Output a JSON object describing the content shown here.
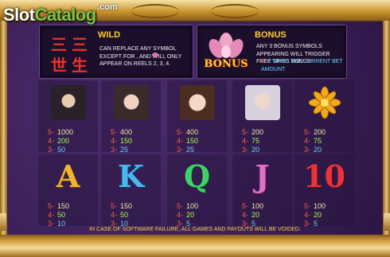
{
  "logo": {
    "text_a": "Slot",
    "text_b": "Catalog",
    "suffix": ".com"
  },
  "wild": {
    "title": "WILD",
    "chars": [
      "三",
      "三",
      "世",
      "生"
    ],
    "text": "CAN REPLACE ANY SYMBOL EXCEPT FOR , AND WILL ONLY APPEAR ON REELS 2, 3, 4."
  },
  "bonus": {
    "title": "BONUS",
    "icon_label": "BONUS",
    "text": "ANY 3 BONUS SYMBOLS APPEARING WILL TRIGGER FREE SPINS BONUS",
    "line_key": "3-",
    "line_value": "2 TIMES THE CURRENT BET AMOUNT."
  },
  "symbols": [
    {
      "name": "warrior",
      "pays": [
        [
          "5-",
          "1000"
        ],
        [
          "4-",
          "200"
        ],
        [
          "3-",
          "50"
        ]
      ]
    },
    {
      "name": "lady",
      "pays": [
        [
          "5-",
          "400"
        ],
        [
          "4-",
          "150"
        ],
        [
          "3-",
          "25"
        ]
      ]
    },
    {
      "name": "princess",
      "pays": [
        [
          "5-",
          "400"
        ],
        [
          "4-",
          "150"
        ],
        [
          "3-",
          "25"
        ]
      ]
    },
    {
      "name": "elder",
      "pays": [
        [
          "5-",
          "200"
        ],
        [
          "4-",
          "75"
        ],
        [
          "3-",
          "20"
        ]
      ]
    },
    {
      "name": "lotus",
      "pays": [
        [
          "5-",
          "200"
        ],
        [
          "4-",
          "75"
        ],
        [
          "3-",
          "20"
        ]
      ]
    },
    {
      "name": "A",
      "pays": [
        [
          "5-",
          "150"
        ],
        [
          "4-",
          "50"
        ],
        [
          "3-",
          "10"
        ]
      ]
    },
    {
      "name": "K",
      "pays": [
        [
          "5-",
          "150"
        ],
        [
          "4-",
          "50"
        ],
        [
          "3-",
          "10"
        ]
      ]
    },
    {
      "name": "Q",
      "pays": [
        [
          "5-",
          "100"
        ],
        [
          "4-",
          "20"
        ],
        [
          "3-",
          "5"
        ]
      ]
    },
    {
      "name": "J",
      "pays": [
        [
          "5-",
          "100"
        ],
        [
          "4-",
          "20"
        ],
        [
          "3-",
          "5"
        ]
      ]
    },
    {
      "name": "10",
      "pays": [
        [
          "5-",
          "100"
        ],
        [
          "4-",
          "20"
        ],
        [
          "3-",
          "5"
        ]
      ]
    }
  ],
  "footer": "IN CASE OF SOFTWARE FAILURE, ALL GAMES AND PAYOUTS WILL BE VOIDED.",
  "colors": {
    "key": "#ff5a4a",
    "pay5": "#f2e6a0",
    "pay4": "#a6ff4a",
    "pay3": "#6ad2ff",
    "title": "#ffcc33"
  }
}
